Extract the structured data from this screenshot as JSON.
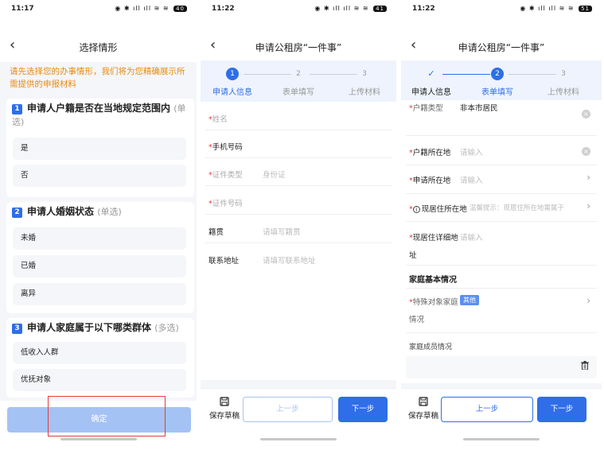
{
  "screen1": {
    "time": "11:17",
    "battery": "40",
    "title": "选择情形",
    "notice": "请先选择您的办事情形，我们将为您精确展示所需提供的申报材料",
    "questions": [
      {
        "num": "1",
        "text": "申请人户籍是否在当地规定范围内",
        "type": "(单选)",
        "options": [
          "是",
          "否"
        ]
      },
      {
        "num": "2",
        "text": "申请人婚姻状态",
        "type": "(单选)",
        "options": [
          "未婚",
          "已婚",
          "离异"
        ]
      },
      {
        "num": "3",
        "text": "申请人家庭属于以下哪类群体",
        "type": "(多选)",
        "options": [
          "低收入人群",
          "优抚对象"
        ]
      }
    ],
    "confirm": "确定"
  },
  "screen2": {
    "time": "11:22",
    "battery": "41",
    "title": "申请公租房“一件事”",
    "steps": [
      {
        "num": "1",
        "label": "申请人信息"
      },
      {
        "num": "2",
        "label": "表单填写"
      },
      {
        "num": "3",
        "label": "上传材料"
      }
    ],
    "fields": [
      {
        "label": "姓名",
        "required": true,
        "value": ""
      },
      {
        "label": "手机号码",
        "required": true,
        "value": ""
      },
      {
        "label": "证件类型",
        "required": true,
        "value": "身份证"
      },
      {
        "label": "证件号码",
        "required": true,
        "value": ""
      },
      {
        "label": "籍贯",
        "required": false,
        "value": "请填写籍贯"
      },
      {
        "label": "联系地址",
        "required": false,
        "value": "请填写联系地址"
      }
    ],
    "save_draft": "保存草稿",
    "prev": "上一步",
    "next": "下一步"
  },
  "screen3": {
    "time": "11:22",
    "battery": "51",
    "title": "申请公租房“一件事”",
    "steps": [
      {
        "num": "✓",
        "label": "申请人信息"
      },
      {
        "num": "2",
        "label": "表单填写"
      },
      {
        "num": "3",
        "label": "上传材料"
      }
    ],
    "fields": [
      {
        "label": "户籍类型",
        "value": "非本市居民"
      },
      {
        "label": "户籍所在地",
        "value": "请输入"
      },
      {
        "label": "申请所在地",
        "value": "请输入"
      },
      {
        "label": "现居住所在地",
        "value": "温馨提示：现居住所在地需属于"
      },
      {
        "label": "现居住详细地",
        "label2": "址",
        "value": "请输入"
      }
    ],
    "section_title": "家庭基本情况",
    "special_label": "特殊对象家庭",
    "special_label2": "情况",
    "special_tag": "其他",
    "members_label": "家庭成员情况",
    "save_draft": "保存草稿",
    "prev": "上一步",
    "next": "下一步"
  },
  "colors": {
    "primary": "#2f6ee8",
    "notice": "#ea8a12",
    "required": "#e23b3b",
    "highlight_box": "#e23b3b"
  }
}
